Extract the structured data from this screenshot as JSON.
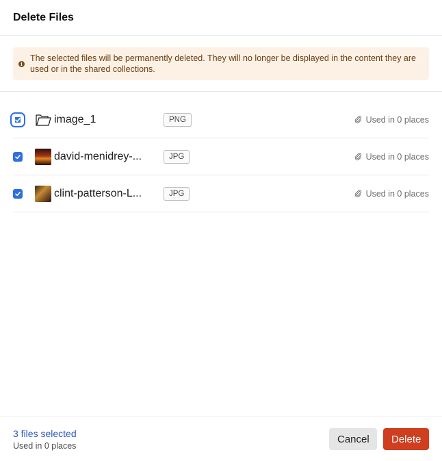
{
  "dialog": {
    "title": "Delete Files",
    "warning": "The selected files will be permanently deleted. They will no longer be displayed in the content they are used or in the shared collections."
  },
  "files": [
    {
      "name": "image_1",
      "type": "PNG",
      "usage": "Used in 0 places",
      "checked": true,
      "thumb": "folder-icon"
    },
    {
      "name": "david-menidrey-...",
      "type": "JPG",
      "usage": "Used in 0 places",
      "checked": true,
      "thumb": "image-thumbnail"
    },
    {
      "name": "clint-patterson-L...",
      "type": "JPG",
      "usage": "Used in 0 places",
      "checked": true,
      "thumb": "image-thumbnail"
    }
  ],
  "footer": {
    "selected_count": "3 files selected",
    "usage": "Used in 0 places",
    "cancel_label": "Cancel",
    "delete_label": "Delete"
  },
  "colors": {
    "accent": "#2f6fe0",
    "danger": "#cf3e1f",
    "warning_bg": "#fdf1e6"
  }
}
